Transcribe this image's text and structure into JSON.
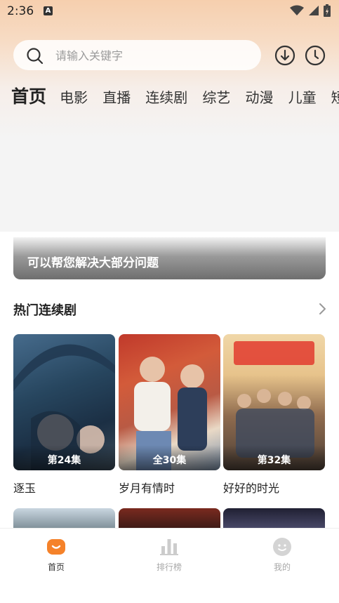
{
  "status_bar": {
    "time": "2:36",
    "notification_icon": "A"
  },
  "search": {
    "placeholder": "请输入关键字"
  },
  "header_actions": {
    "download": "download-icon",
    "history": "clock-icon"
  },
  "tabs": [
    {
      "label": "首页",
      "active": true
    },
    {
      "label": "电影"
    },
    {
      "label": "直播"
    },
    {
      "label": "连续剧"
    },
    {
      "label": "综艺"
    },
    {
      "label": "动漫"
    },
    {
      "label": "儿童"
    },
    {
      "label": "短"
    }
  ],
  "banner": {
    "caption": "可以帮您解决大部分问题"
  },
  "section": {
    "title": "热门连续剧"
  },
  "cards": [
    {
      "title": "逐玉",
      "badge": "第24集"
    },
    {
      "title": "岁月有情时",
      "badge": "全30集"
    },
    {
      "title": "好好的时光",
      "badge": "第32集"
    }
  ],
  "bottom_nav": [
    {
      "label": "首页",
      "active": true
    },
    {
      "label": "排行榜"
    },
    {
      "label": "我的"
    }
  ],
  "colors": {
    "accent": "#f5822a"
  }
}
